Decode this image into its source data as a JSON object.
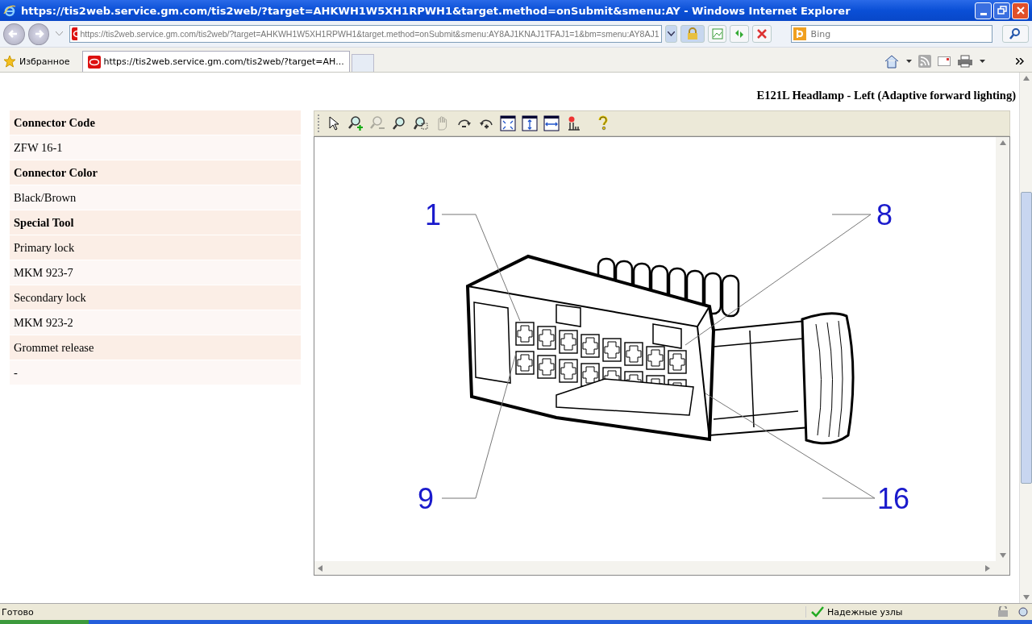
{
  "window": {
    "title": "https://tis2web.service.gm.com/tis2web/?target=AHKWH1W5XH1RPWH1&target.method=onSubmit&smenu:AY - Windows Internet Explorer"
  },
  "address_bar": {
    "url": "https://tis2web.service.gm.com/tis2web/?target=AHKWH1W5XH1RPWH1&target.method=onSubmit&smenu:AY8AJ1KNAJ1TFAJ1=1&bm=smenu:AY8AJ1"
  },
  "search": {
    "placeholder": "Bing"
  },
  "favorites": "Избранное",
  "tabs": [
    {
      "label": "https://tis2web.service.gm.com/tis2web/?target=AH...",
      "selected": true
    }
  ],
  "page": {
    "heading": "E121L Headlamp - Left (Adaptive forward lighting)",
    "properties": [
      {
        "text": "Connector Code",
        "kind": "heading"
      },
      {
        "text": "ZFW 16-1",
        "kind": "value"
      },
      {
        "text": "Connector Color",
        "kind": "heading"
      },
      {
        "text": "Black/Brown",
        "kind": "value"
      },
      {
        "text": "Special Tool",
        "kind": "heading"
      },
      {
        "text": "Primary lock",
        "kind": "label"
      },
      {
        "text": "MKM 923-7",
        "kind": "value"
      },
      {
        "text": "Secondary lock",
        "kind": "label"
      },
      {
        "text": "MKM 923-2",
        "kind": "value"
      },
      {
        "text": "Grommet release",
        "kind": "label"
      },
      {
        "text": "-",
        "kind": "value"
      }
    ]
  },
  "viewer": {
    "toolbar": [
      {
        "kind": "pointer",
        "disabled": false
      },
      {
        "kind": "zoom-in",
        "disabled": false
      },
      {
        "kind": "zoom-out",
        "disabled": true
      },
      {
        "kind": "zoom",
        "disabled": false
      },
      {
        "kind": "zoom-area",
        "disabled": false
      },
      {
        "kind": "pan",
        "disabled": true
      },
      {
        "kind": "rotate-right",
        "disabled": false
      },
      {
        "kind": "rotate-left",
        "disabled": false
      },
      {
        "kind": "fit",
        "disabled": false
      },
      {
        "kind": "fit-height",
        "disabled": false
      },
      {
        "kind": "fit-width",
        "disabled": false
      },
      {
        "kind": "highlight",
        "disabled": false
      },
      {
        "kind": "help",
        "disabled": false
      }
    ],
    "pin_labels": [
      "1",
      "8",
      "9",
      "16"
    ]
  },
  "status_bar": {
    "status": "Готово",
    "zone": "Надежные узлы"
  }
}
